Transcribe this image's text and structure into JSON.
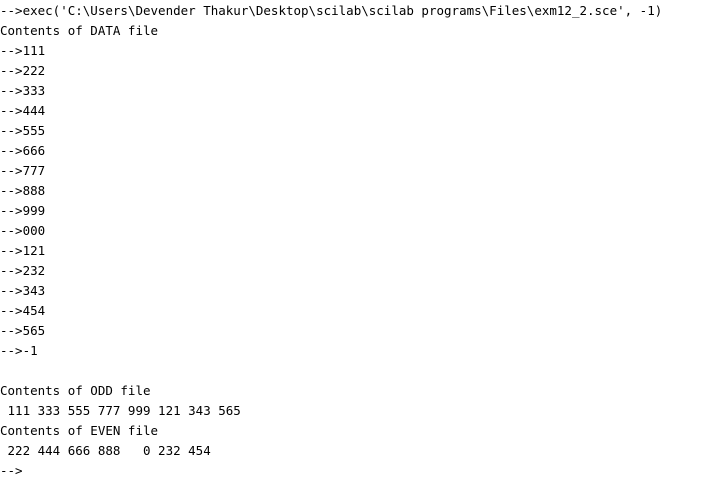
{
  "console": {
    "command_line": "-->exec('C:\\Users\\Devender Thakur\\Desktop\\scilab\\scilab programs\\Files\\exm12_2.sce', -1)",
    "data_heading": "Contents of DATA file",
    "data_inputs": [
      "-->111",
      "-->222",
      "-->333",
      "-->444",
      "-->555",
      "-->666",
      "-->777",
      "-->888",
      "-->999",
      "-->000",
      "-->121",
      "-->232",
      "-->343",
      "-->454",
      "-->565",
      "-->-1"
    ],
    "blank_line": "",
    "odd_heading": "Contents of ODD file",
    "odd_values": " 111 333 555 777 999 121 343 565",
    "even_heading": "Contents of EVEN file",
    "even_values": " 222 444 666 888   0 232 454",
    "final_prompt": "-->"
  }
}
